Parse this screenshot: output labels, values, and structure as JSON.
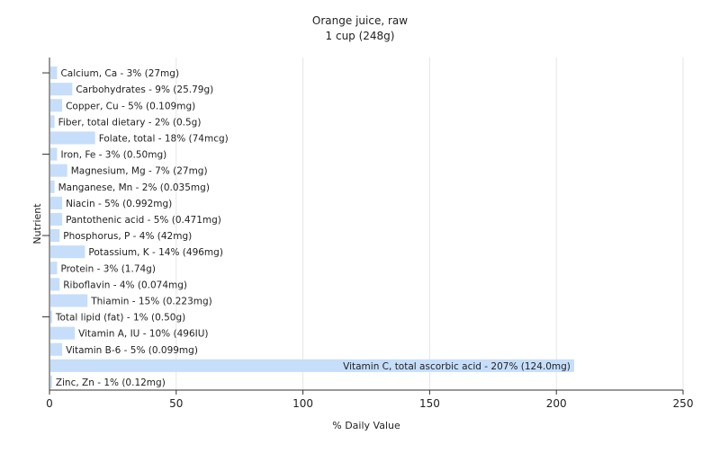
{
  "chart_data": {
    "type": "bar",
    "orientation": "horizontal",
    "title": "Orange juice, raw",
    "subtitle": "1 cup (248g)",
    "xlabel": "% Daily Value",
    "ylabel": "Nutrient",
    "xlim": [
      0,
      250
    ],
    "xticks": [
      0,
      50,
      100,
      150,
      200,
      250
    ],
    "grid": true,
    "bar_color": "#c6defa",
    "categories": [
      "Calcium, Ca - 3% (27mg)",
      "Carbohydrates - 9% (25.79g)",
      "Copper, Cu - 5% (0.109mg)",
      "Fiber, total dietary - 2% (0.5g)",
      "Folate, total - 18% (74mcg)",
      "Iron, Fe - 3% (0.50mg)",
      "Magnesium, Mg - 7% (27mg)",
      "Manganese, Mn - 2% (0.035mg)",
      "Niacin - 5% (0.992mg)",
      "Pantothenic acid - 5% (0.471mg)",
      "Phosphorus, P - 4% (42mg)",
      "Potassium, K - 14% (496mg)",
      "Protein - 3% (1.74g)",
      "Riboflavin - 4% (0.074mg)",
      "Thiamin - 15% (0.223mg)",
      "Total lipid (fat) - 1% (0.50g)",
      "Vitamin A, IU - 10% (496IU)",
      "Vitamin B-6 - 5% (0.099mg)",
      "Vitamin C, total ascorbic acid - 207% (124.0mg)",
      "Zinc, Zn - 1% (0.12mg)"
    ],
    "values": [
      3,
      9,
      5,
      2,
      18,
      3,
      7,
      2,
      5,
      5,
      4,
      14,
      3,
      4,
      15,
      1,
      10,
      5,
      207,
      1
    ]
  }
}
